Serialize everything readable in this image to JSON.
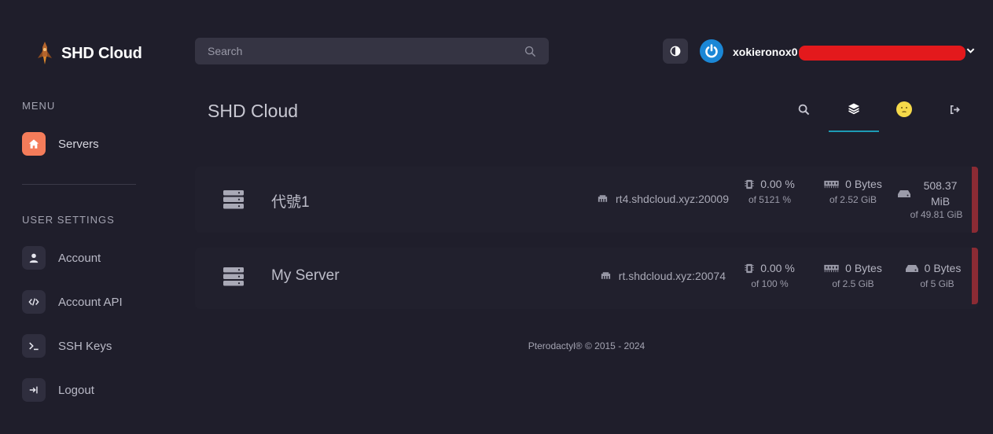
{
  "brand": {
    "name": "SHD Cloud",
    "logo": "rocket-logo"
  },
  "sidebar": {
    "menu_title": "MENU",
    "menu_items": [
      {
        "label": "Servers",
        "icon": "home-icon",
        "active": true
      }
    ],
    "settings_title": "USER SETTINGS",
    "settings_items": [
      {
        "label": "Account",
        "icon": "user-icon"
      },
      {
        "label": "Account API",
        "icon": "code-icon"
      },
      {
        "label": "SSH Keys",
        "icon": "terminal-icon"
      },
      {
        "label": "Logout",
        "icon": "logout-icon"
      }
    ]
  },
  "topbar": {
    "search_placeholder": "Search",
    "username": "xokieronox0",
    "accent": "#1b87d6"
  },
  "header": {
    "title": "SHD Cloud",
    "tabs": [
      "search-icon",
      "layers-icon",
      "emoji-icon",
      "sign-out-icon"
    ],
    "active_tab": 1
  },
  "servers": [
    {
      "name": "代號1",
      "address": "rt4.shdcloud.xyz:20009",
      "cpu": "0.00 %",
      "cpu_limit": "of 5121 %",
      "memory": "0 Bytes",
      "memory_limit": "of 2.52 GiB",
      "disk": "508.37 MiB",
      "disk_limit": "of 49.81 GiB",
      "status_color": "#8b2b34"
    },
    {
      "name": "My Server",
      "address": "rt.shdcloud.xyz:20074",
      "cpu": "0.00 %",
      "cpu_limit": "of 100 %",
      "memory": "0 Bytes",
      "memory_limit": "of 2.5 GiB",
      "disk": "0 Bytes",
      "disk_limit": "of 5 GiB",
      "status_color": "#8b2b34"
    }
  ],
  "footer": {
    "text": "Pterodactyl® © 2015 - 2024"
  }
}
